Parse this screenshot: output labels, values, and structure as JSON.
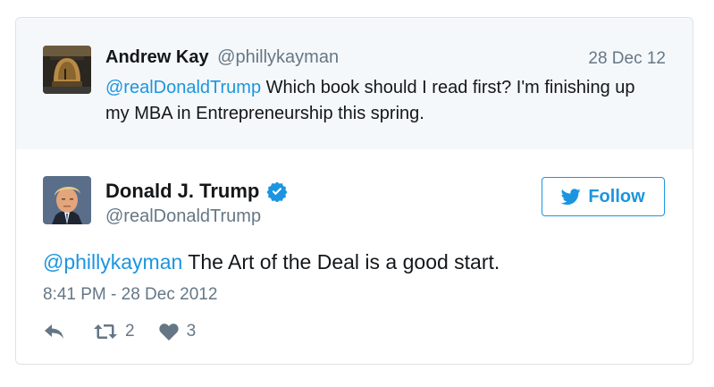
{
  "parent_tweet": {
    "name": "Andrew Kay",
    "handle": "@phillykayman",
    "date": "28 Dec 12",
    "mention": "@realDonaldTrump",
    "text": " Which book should I read first? I'm finishing up my MBA in Entrepreneurship this spring."
  },
  "main_tweet": {
    "name": "Donald J. Trump",
    "handle": "@realDonaldTrump",
    "verified_icon": "verified-badge",
    "follow_label": "Follow",
    "mention": "@phillykayman",
    "text": " The Art of the Deal is a good start.",
    "timestamp": "8:41 PM - 28 Dec 2012",
    "retweet_count": "2",
    "like_count": "3"
  },
  "colors": {
    "accent": "#1b95e0",
    "muted": "#657786",
    "text": "#14171a",
    "parent_bg": "#f5f8fa"
  }
}
